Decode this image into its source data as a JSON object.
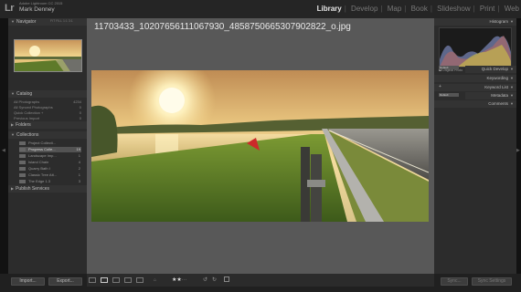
{
  "app": {
    "logo": "Lr",
    "subtitle": "Adobe Lightroom CC 2015",
    "user": "Mark Denney"
  },
  "modules": [
    {
      "label": "Library",
      "active": true
    },
    {
      "label": "Develop"
    },
    {
      "label": "Map"
    },
    {
      "label": "Book"
    },
    {
      "label": "Slideshow"
    },
    {
      "label": "Print"
    },
    {
      "label": "Web"
    }
  ],
  "left_panel": {
    "navigator": "Navigator",
    "zoom_options": "FIT  FILL  1:1  3:1",
    "catalog": "Catalog",
    "catalog_items": [
      {
        "label": "All Photographs",
        "count": "4234"
      },
      {
        "label": "All Synced Photographs",
        "count": "0"
      },
      {
        "label": "Quick Collection +",
        "count": "0"
      },
      {
        "label": "Previous Import",
        "count": "0"
      }
    ],
    "folders": "Folders",
    "collections": "Collections",
    "collection_items": [
      {
        "label": "Project Collecti...",
        "count": ""
      },
      {
        "label": "Progress Colle...",
        "count": "19",
        "selected": true
      },
      {
        "label": "Landscape Imp...",
        "count": "1"
      },
      {
        "label": "Island Chain",
        "count": "4"
      },
      {
        "label": "Quarry Bath I",
        "count": "2"
      },
      {
        "label": "Classic Tree Att...",
        "count": "1"
      },
      {
        "label": "The Edge 1.3",
        "count": "3"
      }
    ],
    "publish_services": "Publish Services",
    "import_label": "Import...",
    "export_label": "Export..."
  },
  "right_panel": {
    "histogram": "Histogram",
    "original_photo": "Original Photo",
    "preset_default": "Default",
    "quick_develop": "Quick Develop",
    "keywording": "Keywording",
    "keyword_list": "Keyword List",
    "metadata": "Metadata",
    "comments": "Comments",
    "sync_label": "Sync...",
    "sync_settings_label": "Sync Settings"
  },
  "photo": {
    "filename": "11703433_10207656111067930_4858750665307902822_o.jpg"
  },
  "toolbar": {
    "rating": 2,
    "rating_max": 5
  }
}
